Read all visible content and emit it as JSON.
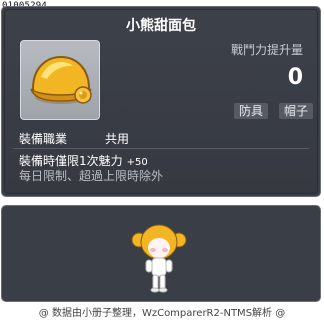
{
  "item_id": "01005294",
  "title": "小熊甜面包",
  "stat_boost": {
    "label": "戰鬥力提升量",
    "value": "0"
  },
  "tags": {
    "armor": "防具",
    "hat": "帽子"
  },
  "job": {
    "label": "裝備職業",
    "value": "共用"
  },
  "effect": {
    "text": "裝備時僅限1次魅力",
    "value": "+50"
  },
  "note": "每日限制、超過上限時除外",
  "footer": "@ 数据由小册子整理，WzComparerR2-NTMS解析 @",
  "colors": {
    "panel_bg": "#3a3e46",
    "text_white": "#ffffff",
    "text_muted": "#b9bdc4",
    "tag_bg": "#555a63",
    "bun_gold": "#f2b625"
  },
  "icons": {
    "item": "bear-bun-hat-icon",
    "preview": "character-wearing-bear-bun-hat"
  }
}
